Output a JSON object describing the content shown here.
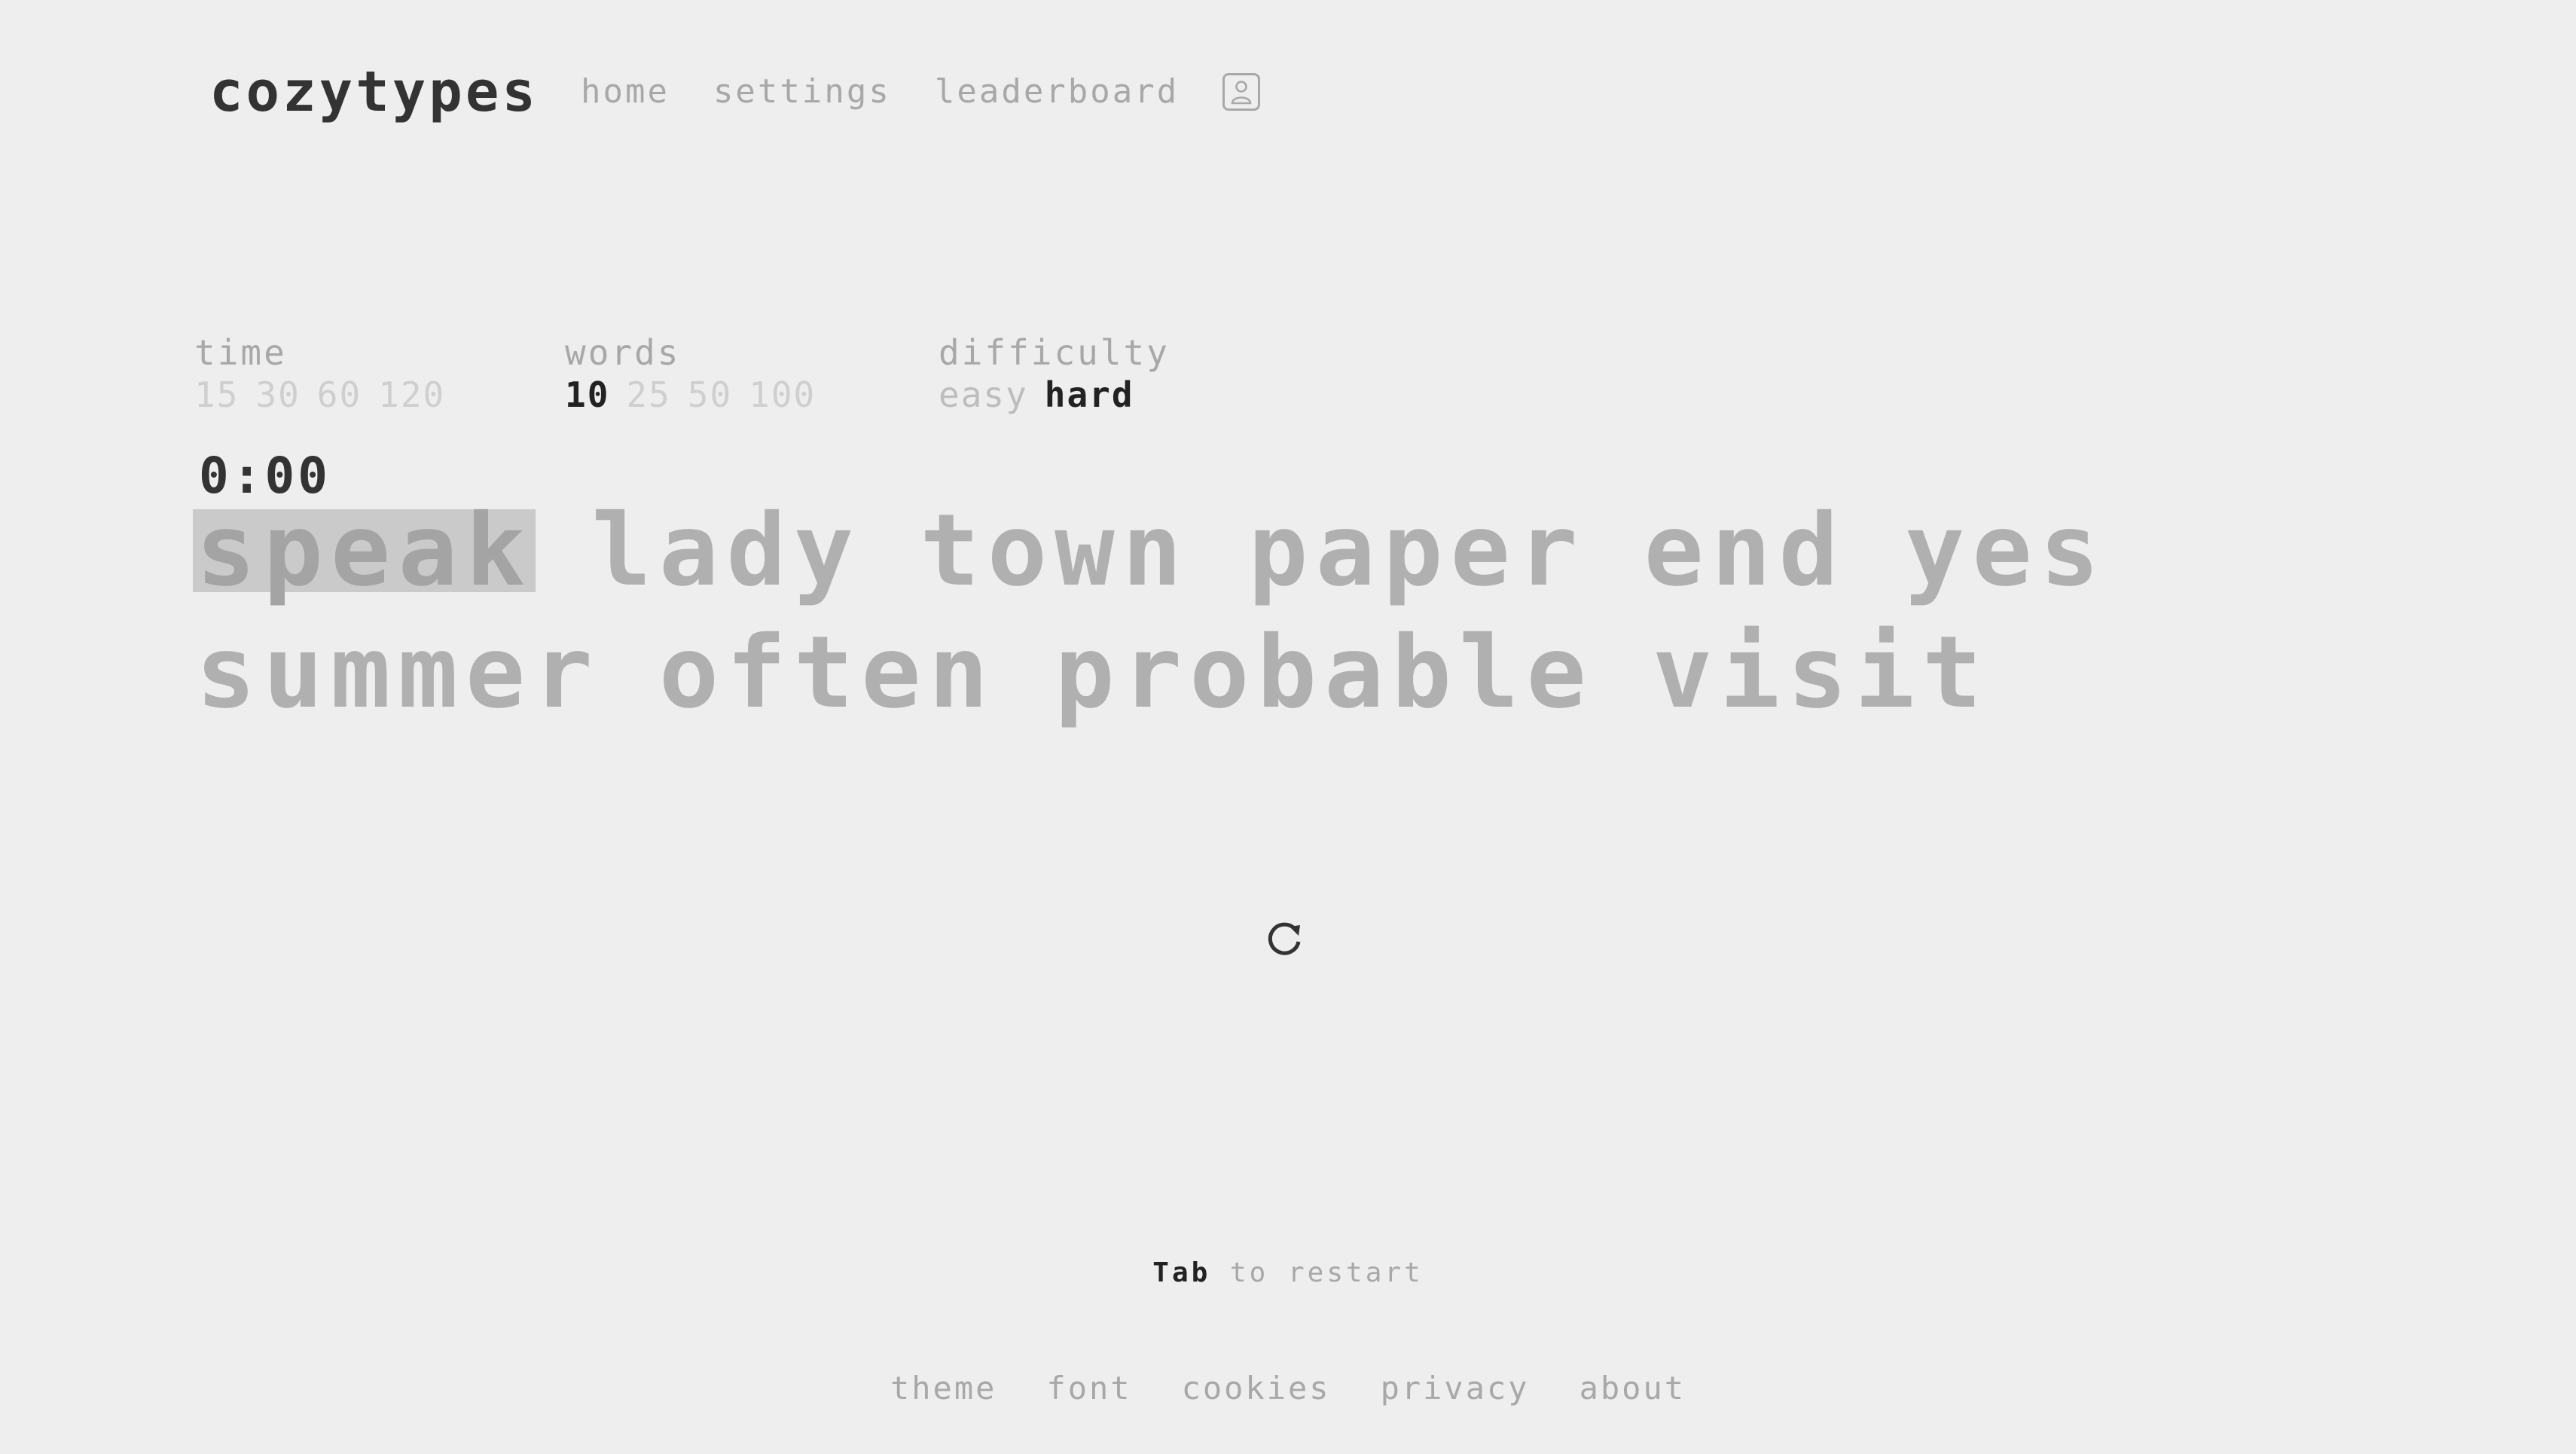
{
  "brand": {
    "name": "cozytypes"
  },
  "nav": {
    "home": "home",
    "settings": "settings",
    "leaderboard": "leaderboard",
    "account_icon": "user-icon"
  },
  "config": {
    "time": {
      "label": "time",
      "options": [
        "15",
        "30",
        "60",
        "120"
      ]
    },
    "words": {
      "label": "words",
      "options": [
        "10",
        "25",
        "50",
        "100"
      ],
      "selected": "10"
    },
    "difficulty": {
      "label": "difficulty",
      "options": [
        "easy",
        "hard"
      ],
      "selected": "hard"
    }
  },
  "timer": "0:00",
  "test": {
    "words": [
      "speak",
      "lady",
      "town",
      "paper",
      "end",
      "yes",
      "summer",
      "often",
      "probable",
      "visit"
    ],
    "current_index": 0
  },
  "restart": {
    "icon": "restart-icon"
  },
  "hint": {
    "key": "Tab",
    "text": "to restart"
  },
  "footer": {
    "theme": "theme",
    "font": "font",
    "cookies": "cookies",
    "privacy": "privacy",
    "about": "about"
  },
  "colors": {
    "background": "#eeeeee",
    "text_dark": "#333333",
    "text_muted": "#a8a8a8",
    "word_pending": "#b0b0b0",
    "current_word_highlight": "#cacaca"
  }
}
